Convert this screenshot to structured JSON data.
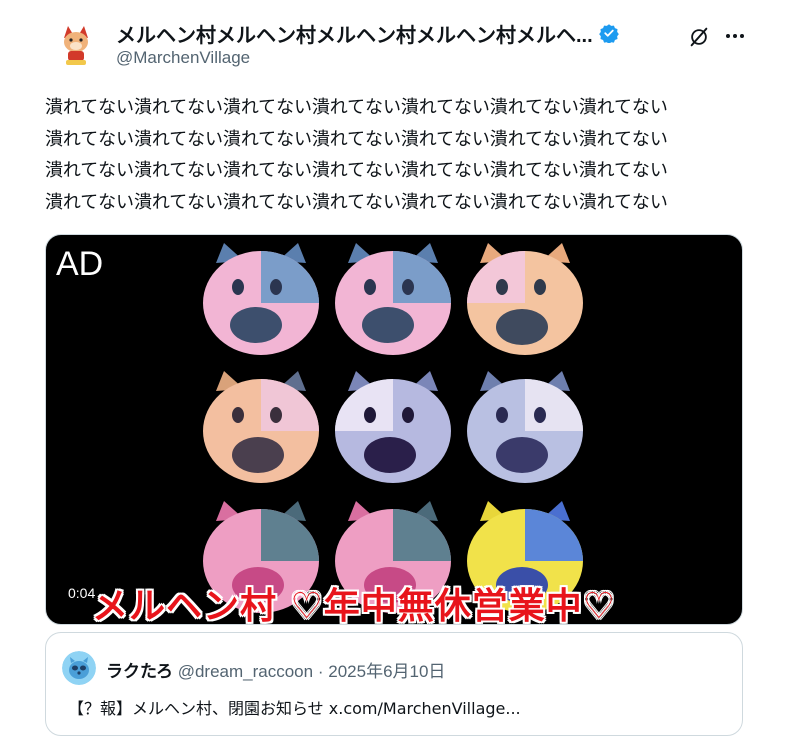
{
  "author": {
    "display_name": "メルヘン村メルヘン村メルヘン村メルヘン村メルヘ...",
    "handle": "@MarchenVillage",
    "avatar_icon": "mascot-avatar-icon",
    "verified": true
  },
  "actions": {
    "grok_icon": "grok-icon",
    "more_icon": "more-icon"
  },
  "tweet": {
    "lines": [
      "潰れてない潰れてない潰れてない潰れてない潰れてない潰れてない潰れてない",
      "潰れてない潰れてない潰れてない潰れてない潰れてない潰れてない潰れてない",
      "潰れてない潰れてない潰れてない潰れてない潰れてない潰れてない潰れてない",
      "潰れてない潰れてない潰れてない潰れてない潰れてない潰れてない潰れてない"
    ]
  },
  "media": {
    "ad_label": "AD",
    "time": "0:04",
    "caption": "メルヘン村 ♡年中無休営業中♡"
  },
  "quote": {
    "name": "ラクたろ",
    "handle": "@dream_raccoon",
    "dot": "·",
    "date": "2025年6月10日",
    "text": "【？報】メルヘン村、閉園お知らせ x.com/MarchenVillage..."
  },
  "colors": {
    "accent": "#1d9bf0",
    "caption": "#e8141b",
    "muted": "#536471"
  }
}
